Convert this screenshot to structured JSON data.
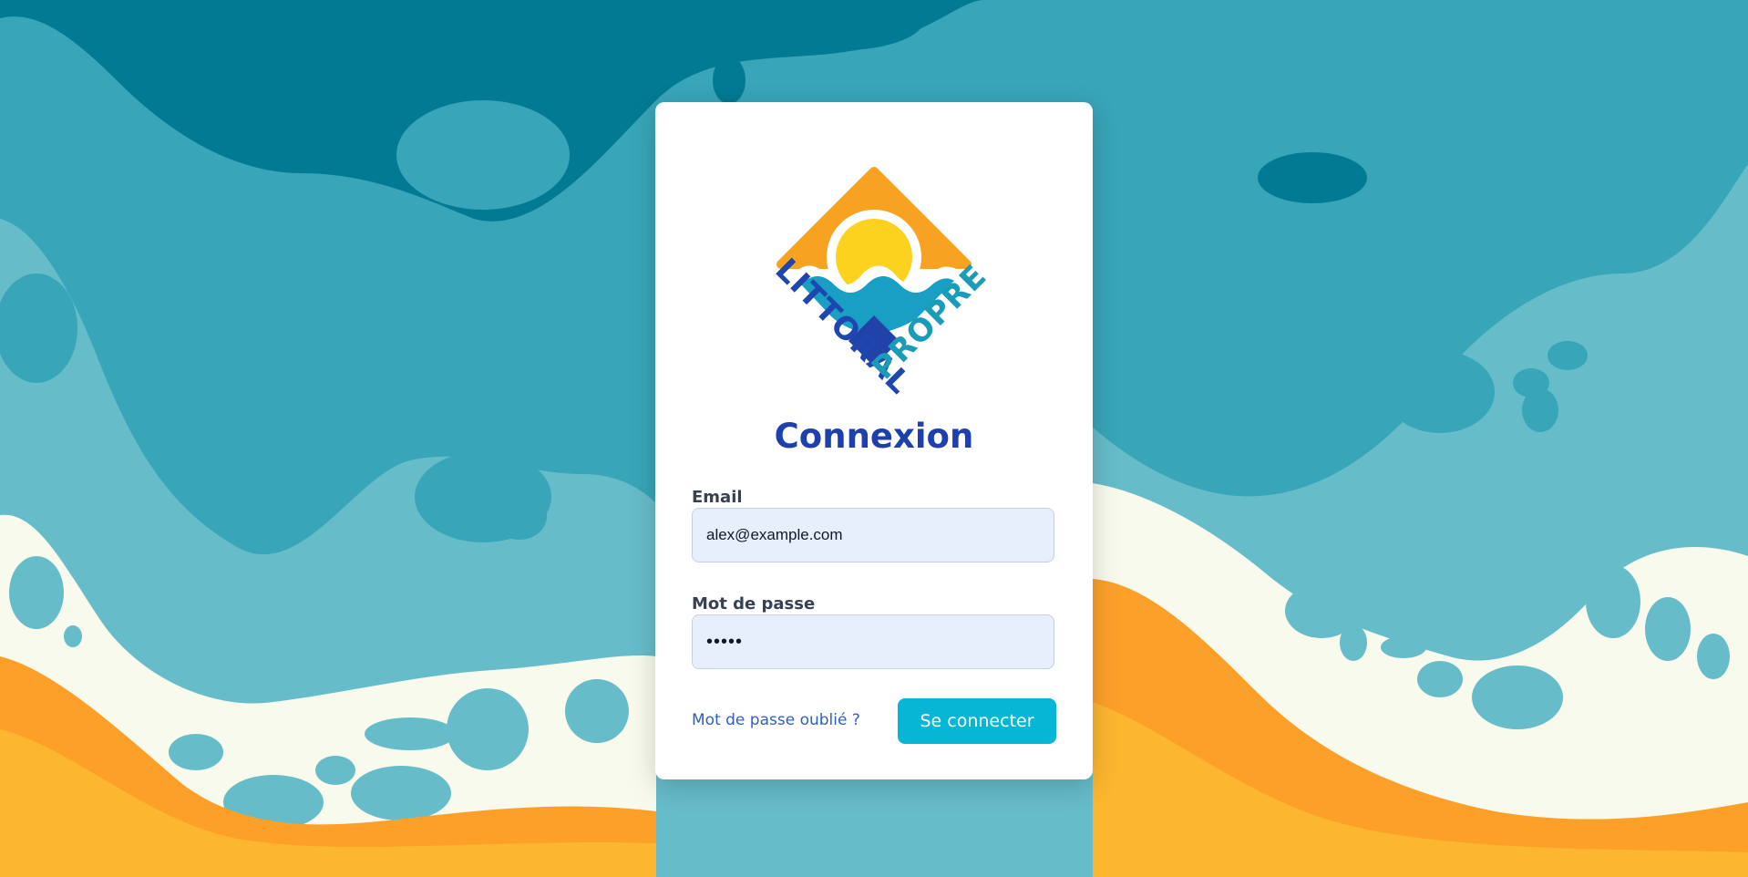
{
  "colors": {
    "deep_sea": "#027a93",
    "mid_sea": "#38a5b8",
    "shallow_sea": "#67bcca",
    "foam": "#f7faec",
    "sand_dark": "#fca02a",
    "sand_light": "#fdb630",
    "title": "#1e40af",
    "button": "#06b6d4",
    "link": "#2f5fc4",
    "input_bg": "#e8effc"
  },
  "logo": {
    "word_left": "LITTORAL",
    "word_right": "PROPRE"
  },
  "login": {
    "title": "Connexion",
    "email_label": "Email",
    "email_value": "alex@example.com",
    "password_label": "Mot de passe",
    "password_value": "•••••",
    "forgot_link": "Mot de passe oublié ?",
    "submit_label": "Se connecter"
  }
}
